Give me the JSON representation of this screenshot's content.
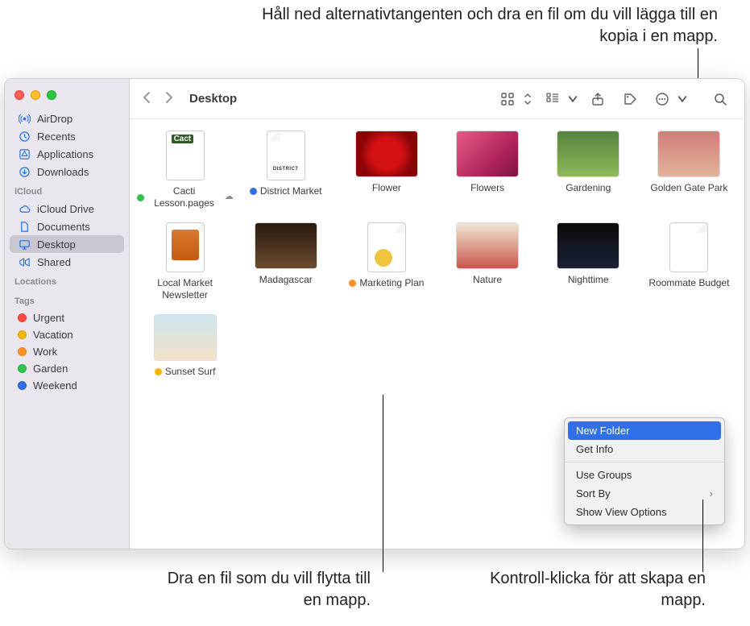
{
  "callouts": {
    "top": "Håll ned alternativtangenten och dra en fil om du vill lägga till en kopia i en mapp.",
    "bottom_left": "Dra en fil som du vill flytta till en mapp.",
    "bottom_right": "Kontroll-klicka för att skapa en mapp."
  },
  "toolbar": {
    "title": "Desktop"
  },
  "sidebar": {
    "favorites": [
      {
        "label": "AirDrop",
        "icon": "airdrop"
      },
      {
        "label": "Recents",
        "icon": "clock"
      },
      {
        "label": "Applications",
        "icon": "apps"
      },
      {
        "label": "Downloads",
        "icon": "download"
      }
    ],
    "icloud_title": "iCloud",
    "icloud": [
      {
        "label": "iCloud Drive",
        "icon": "cloud"
      },
      {
        "label": "Documents",
        "icon": "doc"
      },
      {
        "label": "Desktop",
        "icon": "desktop",
        "selected": true
      },
      {
        "label": "Shared",
        "icon": "shared"
      }
    ],
    "locations_title": "Locations",
    "tags_title": "Tags",
    "tags": [
      {
        "label": "Urgent",
        "color": "#ff4b3e"
      },
      {
        "label": "Vacation",
        "color": "#f7b500"
      },
      {
        "label": "Work",
        "color": "#ff9223"
      },
      {
        "label": "Garden",
        "color": "#30c24c"
      },
      {
        "label": "Weekend",
        "color": "#2f6fe8"
      }
    ]
  },
  "files": [
    {
      "label": "Cacti Lesson.pages",
      "dot": "#30c24c",
      "style": "doc",
      "art": "art-cacti",
      "cloud": true
    },
    {
      "label": "District Market",
      "dot": "#2f6fe8",
      "style": "doc",
      "art": "art-district"
    },
    {
      "label": "Flower",
      "art": "art-flower1"
    },
    {
      "label": "Flowers",
      "art": "art-flowers"
    },
    {
      "label": "Gardening",
      "art": "art-garden"
    },
    {
      "label": "Golden Gate Park",
      "art": "art-gate"
    },
    {
      "label": "Local Market Newsletter",
      "style": "doc",
      "art": "art-localnews"
    },
    {
      "label": "Madagascar",
      "art": "art-mada"
    },
    {
      "label": "Marketing Plan",
      "dot": "#ff9223",
      "style": "doc",
      "art": "art-marketing"
    },
    {
      "label": "Nature",
      "art": "art-nature"
    },
    {
      "label": "Nighttime",
      "art": "art-night"
    },
    {
      "label": "Roommate Budget",
      "style": "doc",
      "art": "art-sheet"
    },
    {
      "label": "Sunset Surf",
      "dot": "#f7b500",
      "art": "art-surf"
    }
  ],
  "context_menu": {
    "items": [
      {
        "label": "New Folder",
        "highlight": true
      },
      {
        "label": "Get Info"
      },
      {
        "sep": true
      },
      {
        "label": "Use Groups"
      },
      {
        "label": "Sort By",
        "submenu": true
      },
      {
        "label": "Show View Options"
      }
    ]
  }
}
